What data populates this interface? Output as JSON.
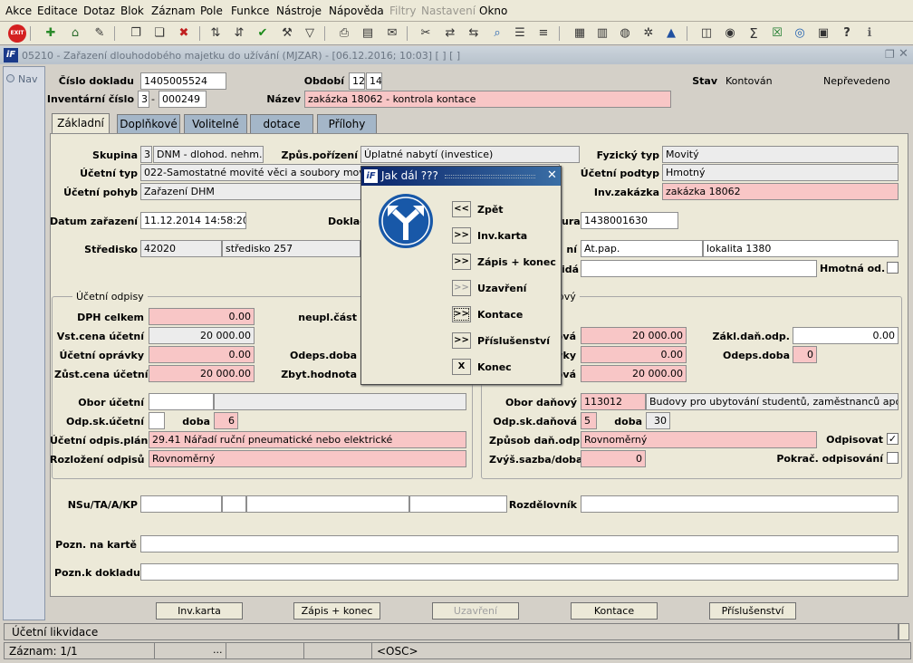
{
  "menu": [
    "Akce",
    "Editace",
    "Dotaz",
    "Blok",
    "Záznam",
    "Pole",
    "Funkce",
    "Nástroje",
    "Nápověda",
    "Filtry",
    "Nastavení",
    "Okno"
  ],
  "window": {
    "title": "05210 - Zařazení dlouhodobého majetku do užívání (MJZAR) - [06.12.2016; 10:03]  [ ]  [ ]"
  },
  "nav": {
    "label": "Nav"
  },
  "header": {
    "cislo_dokladu_label": "Číslo dokladu",
    "cislo_dokladu": "1405005524",
    "obdobi_label": "Období",
    "obdobi_1": "12",
    "obdobi_2": "14",
    "stav_label": "Stav",
    "stav": "Kontován",
    "stav2": "Nepřevedeno",
    "inv_cislo_label": "Inventární číslo",
    "inv_cislo_1": "3",
    "inv_cislo_sep": "-",
    "inv_cislo_2": "000249",
    "nazev_label": "Název",
    "nazev": "zakázka 18062 - kontrola kontace"
  },
  "tabs": [
    "Základní",
    "Doplňkové",
    "Volitelné",
    "dotace",
    "Přílohy"
  ],
  "form": {
    "skupina_label": "Skupina",
    "skupina_1": "3",
    "skupina_2": "DNM - dlohod. nehm. ma",
    "zpus_label": "Způs.pořízení",
    "zpus": "Úplatné nabytí (investice)",
    "fyz_label": "Fyzický typ",
    "fyz": "Movitý",
    "ucet_typ_label": "Účetní typ",
    "ucet_typ": "022-Samostatné movité věci a soubory mov.věcí",
    "ucet_podtyp_label": "Účetní podtyp",
    "ucet_podtyp": "Hmotný",
    "ucet_pohyb_label": "Účetní pohyb",
    "ucet_pohyb": "Zařazení DHM",
    "inv_zak_label": "Inv.zakázka",
    "inv_zak": "zakázka 18062",
    "datum_label": "Datum zařazení",
    "datum": "11.12.2014 14:58:20",
    "doklad_label": "Doklad",
    "faktura_label": "ura",
    "faktura": "1438001630",
    "stredisko_label": "Středisko",
    "stredisko_1": "42020",
    "stredisko_2": "středisko 257",
    "lokalita_label": "ní",
    "lokalita_1": "At.pap.",
    "lokalita_2": "lokalita 1380",
    "odp_osoba_label": "idá",
    "hmotna_label": "Hmotná od."
  },
  "ucetni": {
    "title": "Účetní odpisy",
    "dph_label": "DPH celkem",
    "dph": "0.00",
    "neupl_label": "neupl.část",
    "vst_label": "Vst.cena účetní",
    "vst": "20 000.00",
    "opravky_label": "Účetní oprávky",
    "opravky": "0.00",
    "odeps_label": "Odeps.doba",
    "zust_label": "Zůst.cena účetní",
    "zust": "20 000.00",
    "zbyt_label": "Zbyt.hodnota",
    "obor_label": "Obor účetní",
    "odp_sk_label": "Odp.sk.účetní",
    "doba_label": "doba",
    "doba": "6",
    "plan_label": "Účetní odpis.plán",
    "plan": "29.41 Nářadí ruční pneumatické nebo elektrické",
    "rozlozeni_label": "Rozložení odpisů",
    "rozlozeni": "Rovnoměrný"
  },
  "danove": {
    "title": "ový",
    "vstup_label": "ová",
    "vstup": "20 000.00",
    "zakl_label": "Zákl.daň.odp.",
    "zakl": "0.00",
    "opravky_label": "vky",
    "opravky": "0.00",
    "odeps_label": "Odeps.doba",
    "odeps": "0",
    "zust_label": "ová",
    "zust": "20 000.00",
    "obor_label": "Obor daňový",
    "obor_1": "113012",
    "obor_2": "Budovy pro ubytování studentů, zaměstnanců apod.",
    "odp_sk_label": "Odp.sk.daňová",
    "odp_sk": "5",
    "doba_label": "doba",
    "doba": "30",
    "zpusob_label": "Způsob daň.odp.",
    "zpusob": "Rovnoměrný",
    "odpisovat_label": "Odpisovat",
    "zvys_label": "Zvýš.sazba/doba",
    "zvys": "0",
    "pokrac_label": "Pokrač. odpisování"
  },
  "bottom": {
    "nsu_label": "NSu/TA/A/KP",
    "rozdel_label": "Rozdělovník",
    "pozn_karta_label": "Pozn. na kartě",
    "pozn_doklad_label": "Pozn.k dokladu"
  },
  "buttons": [
    "Inv.karta",
    "Zápis + konec",
    "Uzavření",
    "Kontace",
    "Příslušenství"
  ],
  "dialog": {
    "title": "Jak dál ???",
    "items": [
      {
        "sym": "<<",
        "label": "Zpět"
      },
      {
        "sym": ">>",
        "label": "Inv.karta"
      },
      {
        "sym": ">>",
        "label": "Zápis + konec"
      },
      {
        "sym": ">>",
        "label": "Uzavření"
      },
      {
        "sym": ">>",
        "label": "Kontace"
      },
      {
        "sym": ">>",
        "label": "Příslušenství"
      },
      {
        "sym": "X",
        "label": "Konec"
      }
    ]
  },
  "status": {
    "line1": "Účetní likvidace",
    "zaznam": "Záznam: 1/1",
    "dots": "...",
    "osc": "<OSC>"
  }
}
